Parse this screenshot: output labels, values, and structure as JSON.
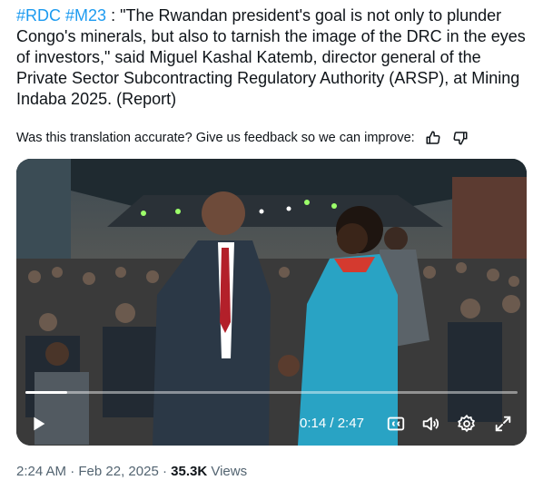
{
  "tweet": {
    "hashtag1": "#RDC",
    "hashtag2": "#M23",
    "body": " : \"The Rwandan president's goal is not only to plunder Congo's minerals, but also to tarnish the image of the DRC in the eyes of investors,\" said Miguel Kashal Katemb, director general of the Private Sector Subcontracting Regulatory Authority (ARSP), at Mining Indaba 2025. (Report)"
  },
  "feedback": {
    "prompt": "Was this translation accurate? Give us feedback so we can improve:",
    "like_icon": "thumbs-up-icon",
    "dislike_icon": "thumbs-down-icon"
  },
  "video": {
    "current_time": "0:14",
    "separator": " / ",
    "duration": "2:47",
    "progress": 0.084,
    "icons": [
      "play-icon",
      "captions-icon",
      "volume-icon",
      "settings-icon",
      "fullscreen-icon"
    ]
  },
  "meta": {
    "time": "2:24 AM",
    "dot1": " · ",
    "date": "Feb 22, 2025",
    "dot2": " · ",
    "views_count": "35.3K",
    "views_label": " Views"
  },
  "colors": {
    "accent": "#1d9bf0",
    "text": "#0f1419",
    "muted": "#536471"
  }
}
